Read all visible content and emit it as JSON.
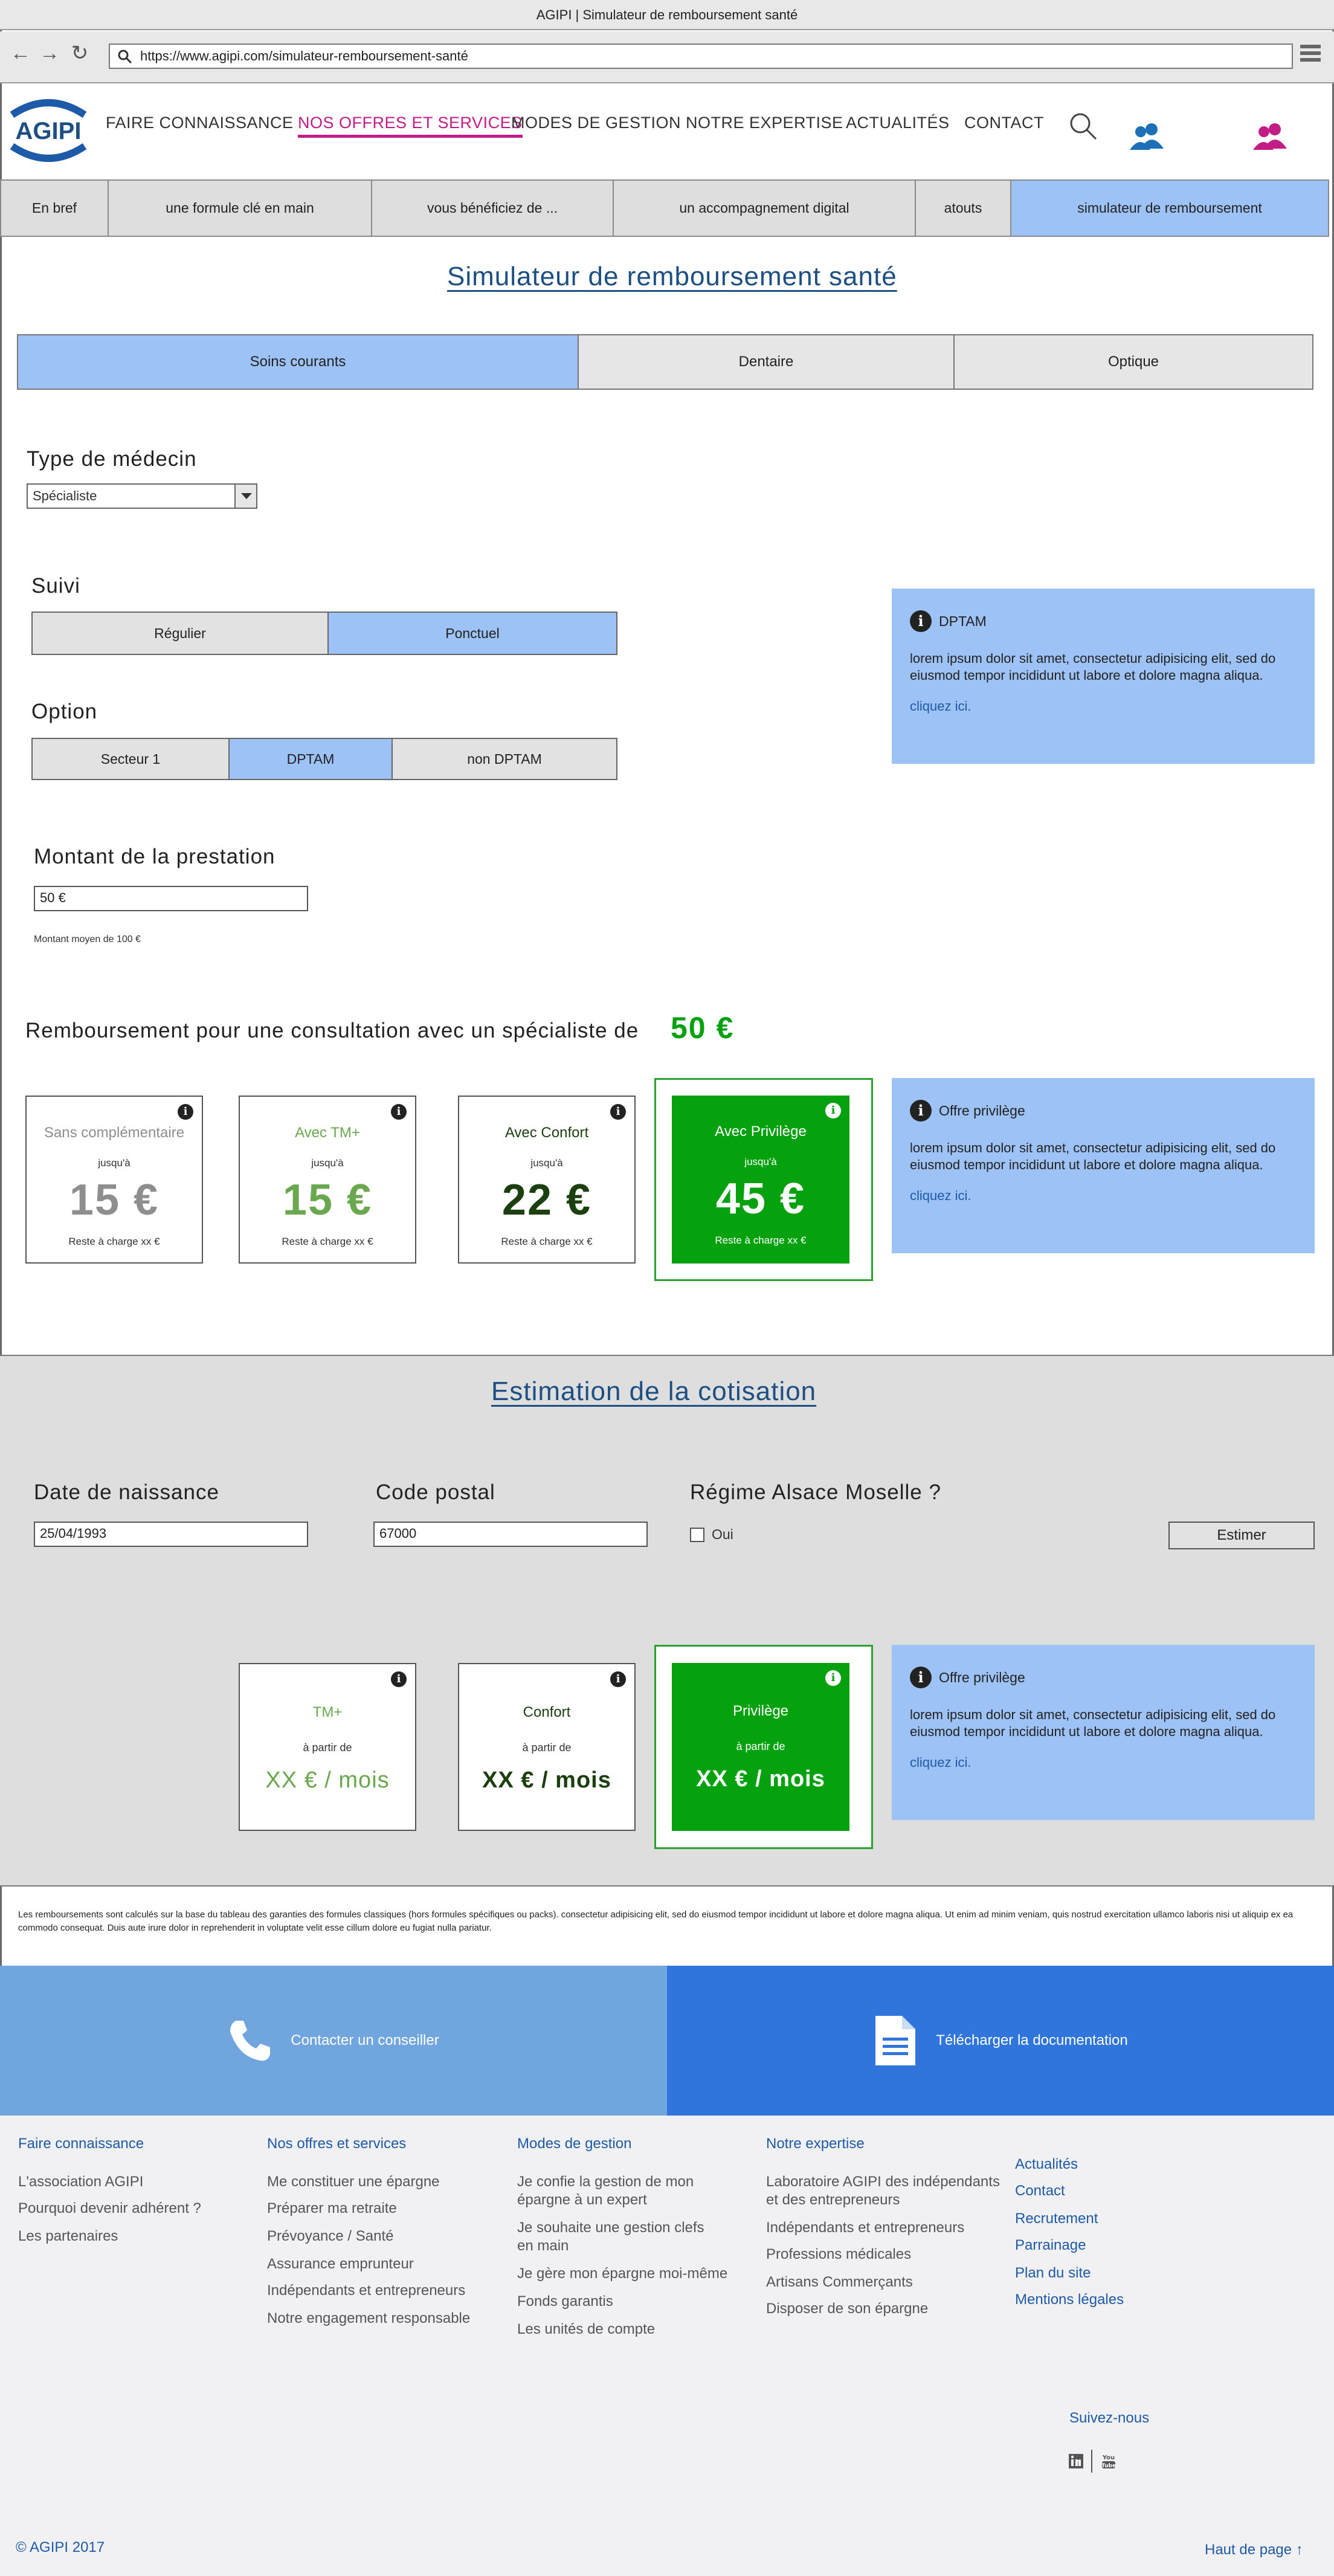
{
  "browser": {
    "window_title": "AGIPI | Simulateur de remboursement santé",
    "url": "https://www.agipi.com/simulateur-remboursement-santé"
  },
  "header": {
    "logo_text": "AGIPI",
    "nav": [
      {
        "label": "FAIRE CONNAISSANCE"
      },
      {
        "label": "NOS OFFRES ET SERVICES"
      },
      {
        "label": "MODES DE GESTION"
      },
      {
        "label": "NOTRE EXPERTISE"
      },
      {
        "label": "ACTUALITÉS"
      },
      {
        "label": "CONTACT"
      }
    ]
  },
  "subnav": [
    {
      "label": "En bref"
    },
    {
      "label": "une formule clé en main"
    },
    {
      "label": "vous bénéficiez de ..."
    },
    {
      "label": "un accompagnement digital"
    },
    {
      "label": "atouts"
    },
    {
      "label": "simulateur de remboursement"
    }
  ],
  "simulator": {
    "title": "Simulateur de remboursement santé",
    "tabs": [
      {
        "label": "Soins courants"
      },
      {
        "label": "Dentaire"
      },
      {
        "label": "Optique"
      }
    ],
    "doctor_type_label": "Type de médecin",
    "doctor_type_value": "Spécialiste",
    "suivi_label": "Suivi",
    "suivi_options": [
      {
        "label": "Régulier"
      },
      {
        "label": "Ponctuel"
      }
    ],
    "option_label": "Option",
    "option_options": [
      {
        "label": "Secteur 1"
      },
      {
        "label": "DPTAM"
      },
      {
        "label": "non DPTAM"
      }
    ],
    "amount_label": "Montant de la prestation",
    "amount_value": "50 €",
    "amount_hint": "Montant moyen de 100 €",
    "info_dptam": {
      "title": "DPTAM",
      "body": "lorem ipsum dolor sit amet, consectetur adipisicing elit, sed do eiusmod tempor incididunt ut labore et dolore magna aliqua.",
      "link": "cliquez ici."
    },
    "result_text": "Remboursement pour une consultation avec un spécialiste de",
    "result_amount": "50 €",
    "cards": [
      {
        "name": "Sans complémentaire",
        "upto": "jusqu'à",
        "amount": "15 €",
        "reste": "Reste à charge xx €",
        "color": "#8e8e8e"
      },
      {
        "name": "Avec TM+",
        "upto": "jusqu'à",
        "amount": "15 €",
        "reste": "Reste à charge xx €",
        "color": "#6aa84f"
      },
      {
        "name": "Avec Confort",
        "upto": "jusqu'à",
        "amount": "22 €",
        "reste": "Reste à charge xx €",
        "color": "#1b3f0f"
      },
      {
        "name": "Avec Privilège",
        "upto": "jusqu'à",
        "amount": "45 €",
        "reste": "Reste à charge xx €",
        "color": "#ffffff"
      }
    ],
    "info_privilege": {
      "title": "Offre privilège",
      "body": "lorem ipsum dolor sit amet, consectetur adipisicing elit, sed do eiusmod tempor incididunt ut labore et dolore magna aliqua.",
      "link": "cliquez ici."
    }
  },
  "estimation": {
    "title": "Estimation de la cotisation",
    "birth_label": "Date de naissance",
    "birth_value": "25/04/1993",
    "postal_label": "Code postal",
    "postal_value": "67000",
    "alsace_label": "Régime Alsace Moselle ?",
    "alsace_option": "Oui",
    "estimate_button": "Estimer",
    "cards": [
      {
        "name": "TM+",
        "from": "à partir de",
        "amount": "XX € / mois"
      },
      {
        "name": "Confort",
        "from": "à partir de",
        "amount": "XX € / mois"
      },
      {
        "name": "Privilège",
        "from": "à partir de",
        "amount": "XX € / mois"
      }
    ],
    "info": {
      "title": "Offre privilège",
      "body": "lorem ipsum dolor sit amet, consectetur adipisicing elit, sed do eiusmod tempor incididunt ut labore et dolore magna aliqua.",
      "link": "cliquez ici."
    }
  },
  "disclaimer": "Les remboursements sont calculés sur la base du tableau des garanties des formules classiques (hors formules spécifiques ou packs). consectetur adipisicing elit, sed do eiusmod tempor incididunt ut labore et dolore magna aliqua. Ut enim ad minim veniam, quis nostrud exercitation ullamco laboris nisi ut aliquip ex ea commodo consequat. Duis aute irure dolor in reprehenderit in voluptate velit esse cillum dolore eu fugiat nulla pariatur.",
  "cta": {
    "contact": "Contacter un conseiller",
    "download": "Télécharger la documentation"
  },
  "footer": {
    "col1": {
      "title": "Faire connaissance",
      "links": [
        "L'association AGIPI",
        "Pourquoi devenir adhérent ?",
        "Les partenaires"
      ]
    },
    "col2": {
      "title": "Nos offres et services",
      "links": [
        "Me constituer une épargne",
        "Préparer ma retraite",
        "Prévoyance / Santé",
        "Assurance emprunteur",
        "Indépendants et entrepreneurs",
        "Notre engagement responsable"
      ]
    },
    "col3": {
      "title": "Modes de gestion",
      "links": [
        "Je confie la gestion de mon épargne à un expert",
        "Je souhaite une gestion clefs en main",
        "Je gère mon épargne moi-même",
        "Fonds garantis",
        "Les unités de compte"
      ]
    },
    "col4": {
      "title": "Notre expertise",
      "links": [
        "Laboratoire AGIPI des indépendants et des entrepreneurs",
        "Indépendants et entrepreneurs",
        "Professions médicales",
        "Artisans Commerçants",
        "Disposer de son épargne"
      ]
    },
    "col5": {
      "links": [
        "Actualités",
        "Contact",
        "Recrutement",
        "Parrainage",
        "Plan du site",
        "Mentions légales"
      ]
    },
    "follow": "Suivez-nous",
    "copyright": "© AGIPI 2017",
    "top": "Haut de page ↑"
  },
  "colors": {
    "accent_blue": "#9dc2f5",
    "brand_pink": "#c21d86",
    "green": "#06a10f",
    "navy": "#1d4f82"
  }
}
